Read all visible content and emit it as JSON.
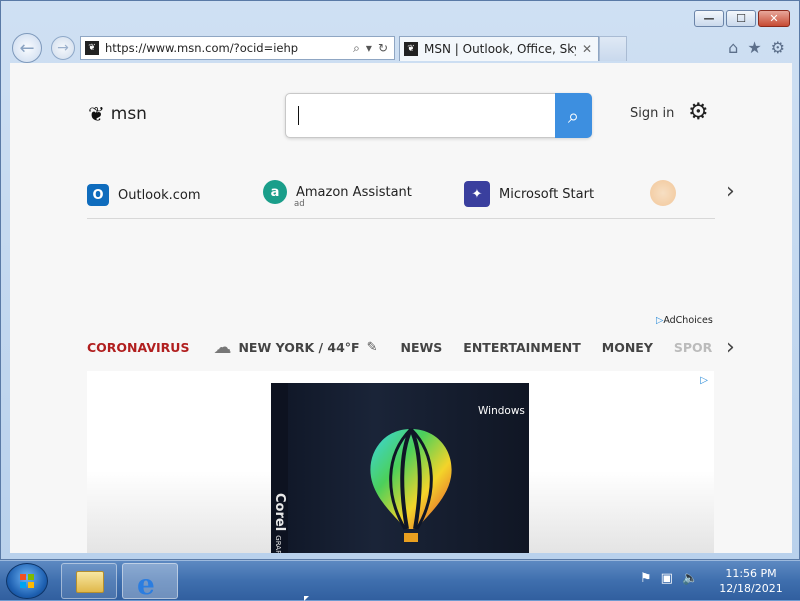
{
  "browser": {
    "url": "https://www.msn.com/?ocid=iehp",
    "tab_title": "MSN | Outlook, Office, Sky...",
    "tab_close": "✕",
    "window_buttons": {
      "minimize": "—",
      "maximize": "☐",
      "close": "✕"
    },
    "icons": {
      "back": "back-arrow-icon",
      "forward": "forward-arrow-icon",
      "home": "home-icon",
      "favorites": "star-icon",
      "tools": "gear-icon"
    }
  },
  "msn": {
    "logo_text": "msn",
    "search_placeholder": "",
    "sign_in": "Sign in",
    "quick_links": [
      {
        "label": "Outlook.com",
        "sub": "",
        "icon_char": "O",
        "color": "#0f6cbd"
      },
      {
        "label": "Amazon Assistant",
        "sub": "ad",
        "icon_char": "a",
        "color": "#1a9e8a"
      },
      {
        "label": "Microsoft Start",
        "sub": "",
        "icon_char": "✦",
        "color": "#3a3f9e"
      }
    ],
    "ad_choices": "AdChoices",
    "nav": {
      "coronavirus": "CORONAVIRUS",
      "weather": "NEW YORK / 44°F",
      "news": "NEWS",
      "entertainment": "ENTERTAINMENT",
      "money": "MONEY",
      "sports": "SPOR"
    },
    "ad": {
      "brand": "Corel",
      "brand_sub": "GRAPHIC SUITE",
      "os": "Windows"
    }
  },
  "taskbar": {
    "time": "11:56 PM",
    "date": "12/18/2021"
  },
  "colors": {
    "accent": "#3d8fe0",
    "coronavirus": "#b11f1f"
  }
}
